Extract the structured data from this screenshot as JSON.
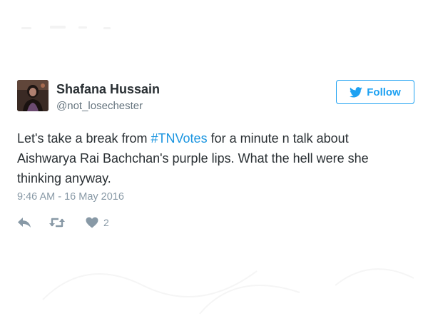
{
  "tweet": {
    "author": {
      "display_name": "Shafana Hussain",
      "username": "@not_losechester",
      "avatar_icon": "profile-photo"
    },
    "follow_button": {
      "label": "Follow",
      "icon": "bird-icon"
    },
    "text": {
      "before_hashtag": "Let's take a break from ",
      "hashtag": "#TNVotes",
      "after_hashtag": " for a minute n talk about Aishwarya Rai Bachchan's purple lips. What the hell were she thinking anyway."
    },
    "timestamp": "9:46 AM - 16 May 2016",
    "actions": {
      "reply_icon": "reply-icon",
      "retweet_icon": "retweet-icon",
      "like_icon": "heart-icon",
      "like_count": "2"
    }
  },
  "colors": {
    "accent": "#1da1f2",
    "hashtag": "#1b95e0",
    "text": "#292f33",
    "muted": "#8899a6",
    "username": "#66757f"
  }
}
